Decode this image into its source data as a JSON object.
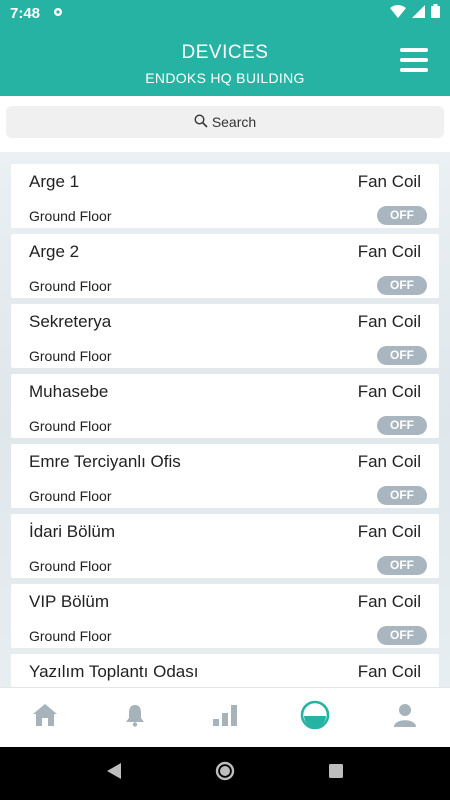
{
  "status_bar": {
    "time": "7:48"
  },
  "header": {
    "title": "DEVICES",
    "subtitle": "ENDOKS HQ BUILDING"
  },
  "search": {
    "label": "Search"
  },
  "devices": [
    {
      "name": "Arge 1",
      "type": "Fan Coil",
      "floor": "Ground Floor",
      "state": "OFF"
    },
    {
      "name": "Arge 2",
      "type": "Fan Coil",
      "floor": "Ground Floor",
      "state": "OFF"
    },
    {
      "name": "Sekreterya",
      "type": "Fan Coil",
      "floor": "Ground Floor",
      "state": "OFF"
    },
    {
      "name": "Muhasebe",
      "type": "Fan Coil",
      "floor": "Ground Floor",
      "state": "OFF"
    },
    {
      "name": "Emre Terciyanlı Ofis",
      "type": "Fan Coil",
      "floor": "Ground Floor",
      "state": "OFF"
    },
    {
      "name": "İdari Bölüm",
      "type": "Fan Coil",
      "floor": "Ground Floor",
      "state": "OFF"
    },
    {
      "name": "VIP Bölüm",
      "type": "Fan Coil",
      "floor": "Ground Floor",
      "state": "OFF"
    },
    {
      "name": "Yazılım Toplantı Odası",
      "type": "Fan Coil",
      "floor": "",
      "state": ""
    }
  ],
  "bottom_nav": [
    {
      "icon": "home-icon",
      "active": false
    },
    {
      "icon": "bell-icon",
      "active": false
    },
    {
      "icon": "bar-chart-icon",
      "active": false
    },
    {
      "icon": "devices-icon",
      "active": true
    },
    {
      "icon": "user-icon",
      "active": false
    }
  ],
  "colors": {
    "primary": "#27b3a3",
    "toggle_off": "#a9b6bf",
    "nav_inactive": "#a7b3bb"
  }
}
